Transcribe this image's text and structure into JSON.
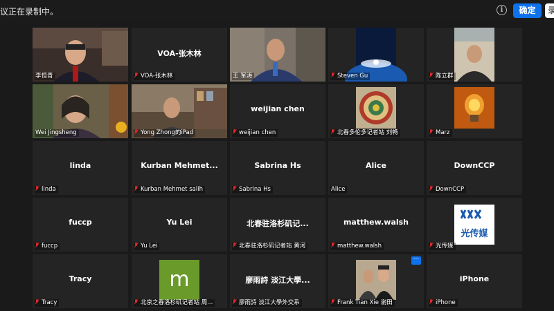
{
  "topbar": {
    "recording_text": "议正在录制中。",
    "info_icon": "info-icon",
    "confirm_label": "确定",
    "second_button_label": "录"
  },
  "colors": {
    "accent": "#0e72ed",
    "muted_mic": "#e02828",
    "active_speaker_border": "#d8d050",
    "tile_bg": "#242424"
  },
  "participants": [
    {
      "label": "李恒青",
      "center": ""
    },
    {
      "label": "VOA-张木林",
      "center": "VOA-张木林"
    },
    {
      "label": "王 军涛",
      "center": ""
    },
    {
      "label": "Steven Gu",
      "center": ""
    },
    {
      "label": "陈立群",
      "center": ""
    },
    {
      "label": "Wei Jingsheng",
      "center": ""
    },
    {
      "label": "Yong Zhong的iPad",
      "center": ""
    },
    {
      "label": "weijian chen",
      "center": "weijian chen"
    },
    {
      "label": "北春多伦多记者站 刘畅",
      "center": ""
    },
    {
      "label": "Marz",
      "center": ""
    },
    {
      "label": "linda",
      "center": "linda"
    },
    {
      "label": "Kurban Mehmet salih",
      "center": "Kurban  Mehmet..."
    },
    {
      "label": "Sabrina Hs",
      "center": "Sabrina Hs"
    },
    {
      "label": "Alice",
      "center": "Alice"
    },
    {
      "label": "DownCCP",
      "center": "DownCCP"
    },
    {
      "label": "fuccp",
      "center": "fuccp"
    },
    {
      "label": "Yu Lei",
      "center": "Yu Lei"
    },
    {
      "label": "北春驻洛杉矶记者站  黄河",
      "center": "北春驻洛杉矶记..."
    },
    {
      "label": "matthew.walsh",
      "center": "matthew.walsh"
    },
    {
      "label": "光传媒",
      "center": ""
    },
    {
      "label": "Tracy",
      "center": "Tracy"
    },
    {
      "label": "北京之春洛杉矶记者站 周...",
      "center": ""
    },
    {
      "label": "廖雨詩 淡江大學外交系",
      "center": "廖雨詩 淡江大學..."
    },
    {
      "label": "Frank Tian Xie 谢田",
      "center": ""
    },
    {
      "label": "iPhone",
      "center": "iPhone"
    }
  ],
  "avatars": {
    "m_letter": "m",
    "gcm_logo_text": "光传媒"
  },
  "more_button": "···"
}
